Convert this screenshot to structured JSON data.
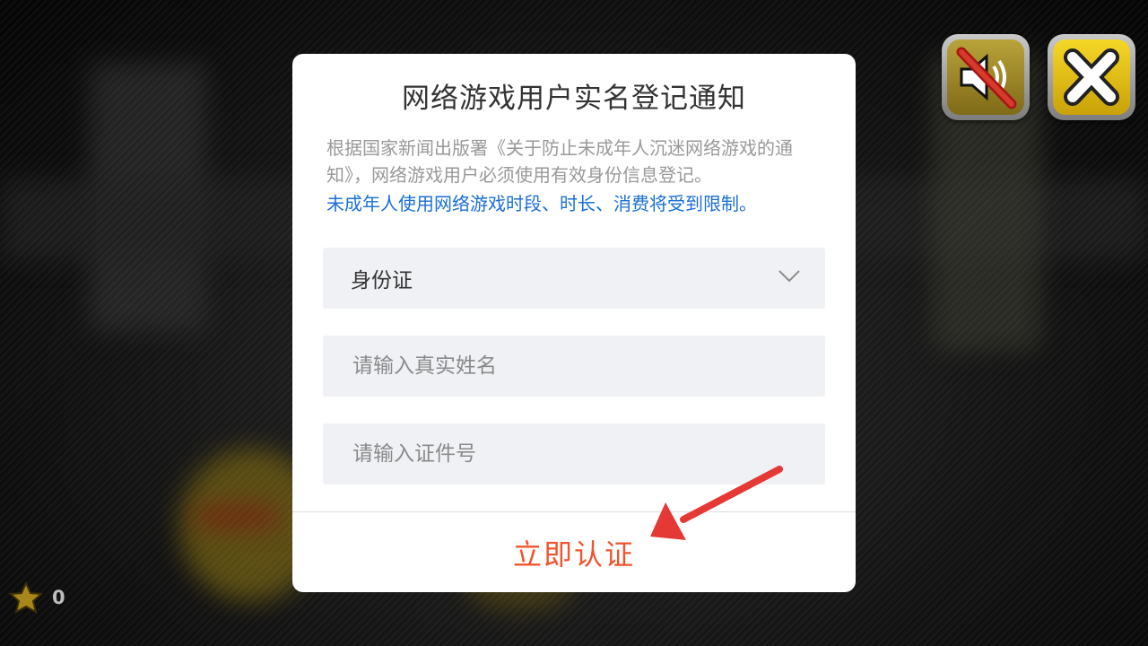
{
  "dialog": {
    "title": "网络游戏用户实名登记通知",
    "notice": "根据国家新闻出版署《关于防止未成年人沉迷网络游戏的通知》，网络游戏用户必须使用有效身份信息登记。",
    "warning": "未成年人使用网络游戏时段、时长、消费将受到限制。",
    "id_type": {
      "selected": "身份证"
    },
    "name_field": {
      "placeholder": "请输入真实姓名",
      "value": ""
    },
    "id_field": {
      "placeholder": "请输入证件号",
      "value": ""
    },
    "submit_label": "立即认证"
  },
  "hud": {
    "star_count": "0",
    "mute_icon": "speaker-muted-icon",
    "close_icon": "close-x-icon"
  },
  "colors": {
    "accent_submit": "#f0542d",
    "warning_text": "#1a6fd6",
    "annotation_arrow": "#e53935",
    "close_button": "#f5d726"
  }
}
